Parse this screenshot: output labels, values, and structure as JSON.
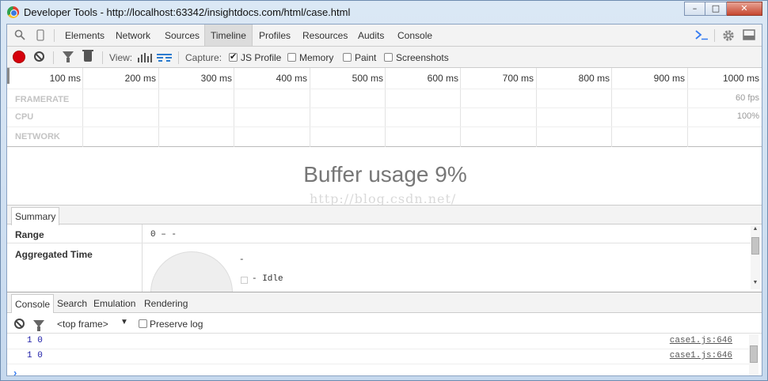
{
  "window": {
    "title": "Developer Tools - http://localhost:63342/insightdocs.com/html/case.html",
    "minimize_glyph": "–",
    "maximize_glyph": "□",
    "close_glyph": "✕"
  },
  "tabs": [
    {
      "label": "Elements"
    },
    {
      "label": "Network"
    },
    {
      "label": "Sources"
    },
    {
      "label": "Timeline",
      "active": true
    },
    {
      "label": "Profiles"
    },
    {
      "label": "Resources"
    },
    {
      "label": "Audits"
    },
    {
      "label": "Console"
    }
  ],
  "timeline_toolbar": {
    "view_label": "View:",
    "capture_label": "Capture:",
    "options": [
      {
        "label": "JS Profile",
        "checked": true
      },
      {
        "label": "Memory",
        "checked": false
      },
      {
        "label": "Paint",
        "checked": false
      },
      {
        "label": "Screenshots",
        "checked": false
      }
    ]
  },
  "overview": {
    "ticks": [
      "100 ms",
      "200 ms",
      "300 ms",
      "400 ms",
      "500 ms",
      "600 ms",
      "700 ms",
      "800 ms",
      "900 ms",
      "1000 ms"
    ],
    "rows": [
      {
        "label": "FRAMERATE",
        "right": "60 fps"
      },
      {
        "label": "CPU",
        "right": "100%"
      },
      {
        "label": "NETWORK",
        "right": ""
      }
    ]
  },
  "buffer": {
    "text": "Buffer usage 9%",
    "watermark": "http://blog.csdn.net/"
  },
  "summary": {
    "tab_label": "Summary",
    "range_label": "Range",
    "range_value": "0 – -",
    "aggregated_label": "Aggregated Time",
    "aggregated_value": "-",
    "legend_item": "- Idle"
  },
  "drawer": {
    "tabs": [
      {
        "label": "Console",
        "active": true
      },
      {
        "label": "Search"
      },
      {
        "label": "Emulation"
      },
      {
        "label": "Rendering"
      }
    ],
    "frame_select": "<top frame>",
    "preserve_log": "Preserve log",
    "messages": [
      {
        "text": "1 0",
        "source": "case1.js:646"
      },
      {
        "text": "1 0",
        "source": "case1.js:646"
      }
    ],
    "prompt": "›"
  }
}
